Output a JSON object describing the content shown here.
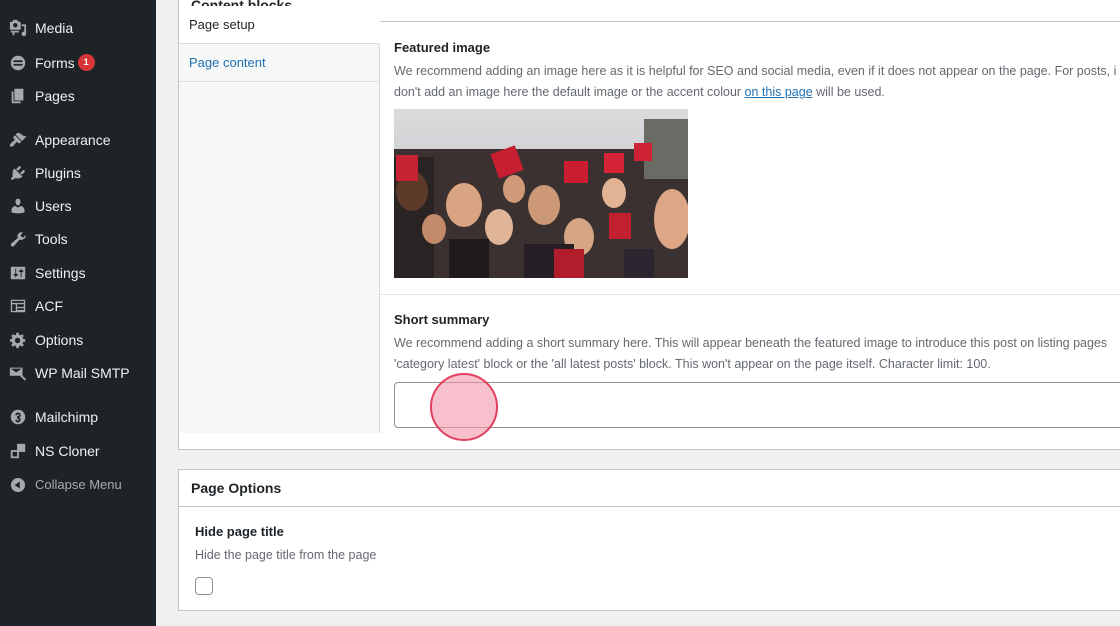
{
  "sidebar": {
    "items": [
      {
        "label": "Media",
        "icon": "media-icon"
      },
      {
        "label": "Forms",
        "icon": "forms-icon",
        "badge": "1"
      },
      {
        "label": "Pages",
        "icon": "pages-icon"
      },
      {
        "label": "Appearance",
        "icon": "appearance-icon"
      },
      {
        "label": "Plugins",
        "icon": "plugins-icon"
      },
      {
        "label": "Users",
        "icon": "users-icon"
      },
      {
        "label": "Tools",
        "icon": "tools-icon"
      },
      {
        "label": "Settings",
        "icon": "settings-icon"
      },
      {
        "label": "ACF",
        "icon": "acf-icon"
      },
      {
        "label": "Options",
        "icon": "options-icon"
      },
      {
        "label": "WP Mail SMTP",
        "icon": "mail-icon"
      },
      {
        "label": "Mailchimp",
        "icon": "mailchimp-icon"
      },
      {
        "label": "NS Cloner",
        "icon": "cloner-icon"
      }
    ],
    "collapse_label": "Collapse Menu"
  },
  "content_blocks": {
    "title": "Content blocks",
    "tabs": [
      "Page setup",
      "Page content"
    ],
    "featured_image": {
      "label": "Featured image",
      "desc_line1": "We recommend adding an image here as it is helpful for SEO and social media, even if it does not appear on the page. For posts, i",
      "desc_line2_pre": "don't add an image here the default image or the accent colour ",
      "desc_link": "on this page",
      "desc_line2_post": " will be used."
    },
    "short_summary": {
      "label": "Short summary",
      "desc_line1": "We recommend adding a short summary here. This will appear beneath the featured image to introduce this post on listing pages",
      "desc_line2": "'category latest' block or the 'all latest posts' block. This won't appear on the page itself. Character limit: 100.",
      "value": ""
    }
  },
  "page_options": {
    "title": "Page Options",
    "hide_title_label": "Hide page title",
    "hide_title_desc": "Hide the page title from the page",
    "hide_title_checked": false
  },
  "colors": {
    "sidebar_bg": "#1d2327",
    "link": "#2271b1",
    "badge": "#d63638"
  }
}
